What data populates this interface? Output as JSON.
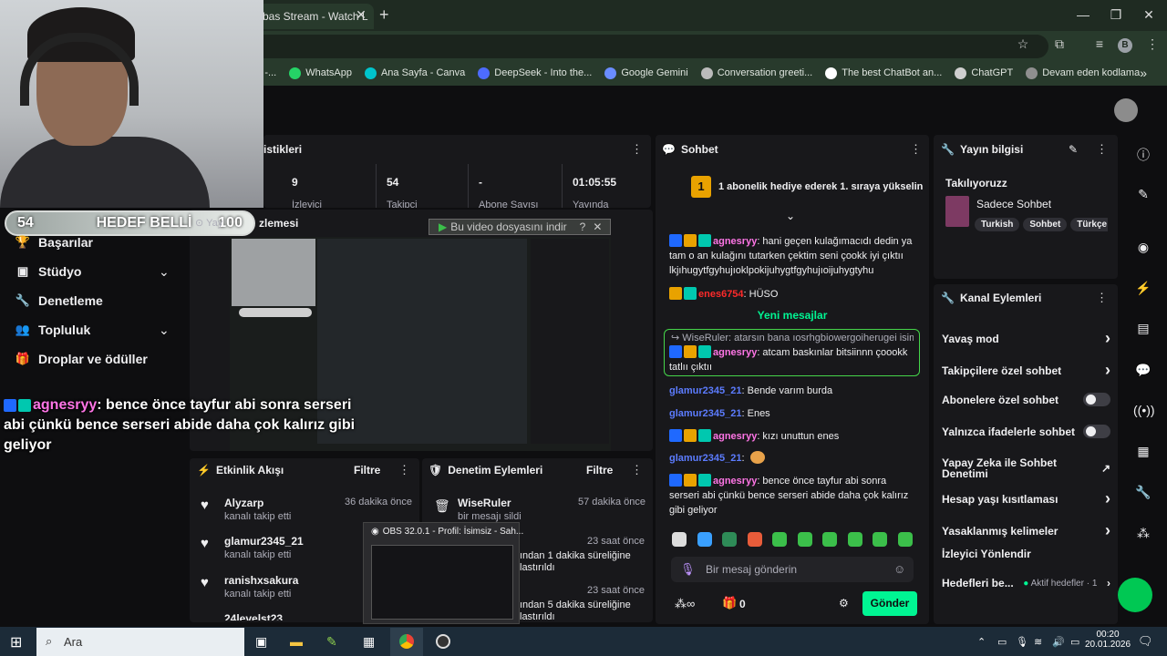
{
  "browser": {
    "tab_title": "bas Stream - Watch L",
    "close_tab": "✕",
    "new_tab": "+",
    "window_controls": {
      "minimize": "—",
      "maximize": "❐",
      "close": "✕"
    },
    "profile_initial": "B",
    "bookmarks": [
      {
        "label": "WiseRuler Stream -...",
        "color": "#8c8c8c"
      },
      {
        "label": "WhatsApp",
        "color": "#25d366"
      },
      {
        "label": "Ana Sayfa - Canva",
        "color": "#00c4cc"
      },
      {
        "label": "DeepSeek - Into the...",
        "color": "#4d6bfe"
      },
      {
        "label": "Google Gemini",
        "color": "#6a8cff"
      },
      {
        "label": "Conversation greeti...",
        "color": "#bbbbbb"
      },
      {
        "label": "The best ChatBot an...",
        "color": "#ffffff"
      },
      {
        "label": "ChatGPT",
        "color": "#cfcfcf"
      },
      {
        "label": "Devam eden kodlama",
        "color": "#8f8f8f"
      }
    ],
    "more_bookmarks": "»"
  },
  "goal": {
    "left": "54",
    "label": "HEDEF BELLİ",
    "right": "100"
  },
  "nav": {
    "items": [
      {
        "label": "Başarılar",
        "icon": "trophy-icon",
        "glyph": "🏆",
        "chevron": false
      },
      {
        "label": "Stüdyo",
        "icon": "studio-icon",
        "glyph": "▣",
        "chevron": true
      },
      {
        "label": "Denetleme",
        "icon": "sword-icon",
        "glyph": "🔧",
        "chevron": false
      },
      {
        "label": "Topluluk",
        "icon": "community-icon",
        "glyph": "👥",
        "chevron": true
      },
      {
        "label": "Droplar ve ödüller",
        "icon": "gift-icon",
        "glyph": "🎁",
        "chevron": false
      }
    ],
    "preview_title_left": "Yay",
    "preview_title_right": "zlemesi"
  },
  "overlay_chat": {
    "user": "agnesryy",
    "text": ": bence önce tayfur abi sonra serseri abi çünkü bence serseri abide daha çok kalırız gibi geliyor"
  },
  "stats": {
    "title": "istikleri",
    "values": [
      {
        "value": "9",
        "label": "İzleyici"
      },
      {
        "value": "54",
        "label": "Takipçi"
      },
      {
        "value": "-",
        "label": "Abone Sayısı"
      },
      {
        "value": "01:05:55",
        "label": "Yayında"
      }
    ]
  },
  "preview": {
    "download_text": "Bu video dosyasını indir",
    "help": "?",
    "close": "✕"
  },
  "activity": {
    "title": "Etkinlik Akışı",
    "filter": "Filtre",
    "items": [
      {
        "name": "Alyzarp",
        "sub": "kanalı takip etti",
        "time": "36 dakika önce"
      },
      {
        "name": "glamur2345_21",
        "sub": "kanalı takip etti",
        "time": ""
      },
      {
        "name": "ranishxsakura",
        "sub": "kanalı takip etti",
        "time": ""
      }
    ],
    "partial": "24levelst23"
  },
  "modlog": {
    "title": "Denetim Eylemleri",
    "filter": "Filtre",
    "items": [
      {
        "name": "WiseRuler",
        "sub": "bir mesajı sildi",
        "time": "57 dakika önce"
      },
      {
        "line1": "ından 1 dakika süreliğine",
        "line2": "lastırıldı",
        "time": "23 saat önce"
      },
      {
        "line1": "ından 5 dakika süreliğine",
        "line2": "lastırıldı",
        "time": "23 saat önce"
      }
    ]
  },
  "obs": {
    "title": "OBS 32.0.1 - Profil: İsimsiz - Sah..."
  },
  "chat": {
    "title": "Sohbet",
    "hype_rank": "1",
    "hype_text": "1 abonelik hediye ederek 1. sıraya yükselin",
    "new_messages": "Yeni mesajlar",
    "reply_context": "WiseRuler: atarsın bana ıosrhgbiowergoiherugei isimil...",
    "messages": [
      {
        "user": "agnesryy",
        "color": "#ff75e6",
        "text": ": hani geçen kulağımacıdı dedin ya tam o an kulağını tutarken çektim seni çookk iyi çıktıı lkjıhugytfgyhujıoklpokijuhygtfgyhujıoijuhygtyhu"
      },
      {
        "user": "enes6754",
        "color": "#ff2a2a",
        "text": ": HÜSO"
      },
      {
        "user": "agnesryy",
        "color": "#ff75e6",
        "text": ": atcam baskınlar bitsiinnn çoookk tatlıı çıktıı"
      },
      {
        "user": "glamur2345_21",
        "color": "#5c7cff",
        "text": ": Bende varım burda"
      },
      {
        "user": "glamur2345_21",
        "color": "#5c7cff",
        "text": ": Enes"
      },
      {
        "user": "agnesryy",
        "color": "#ff75e6",
        "text": ": kızı unuttun enes"
      },
      {
        "user": "glamur2345_21",
        "color": "#5c7cff",
        "text": ":"
      },
      {
        "user": "agnesryy",
        "color": "#ff75e6",
        "text": ": bence önce tayfur abi sonra serseri abi çünkü bence serseri abide daha çok kalırız gibi geliyor"
      }
    ],
    "input_placeholder": "Bir mesaj gönderin",
    "points": "0",
    "send": "Gönder"
  },
  "stream_info": {
    "title": "Yayın bilgisi",
    "stream_title": "Takılıyoruzz",
    "category": "Sadece Sohbet",
    "tags": [
      "Turkish",
      "Sohbet",
      "Türkçe"
    ]
  },
  "channel_actions": {
    "title": "Kanal Eylemleri",
    "items": [
      {
        "label": "Yavaş mod",
        "control": "arrow"
      },
      {
        "label": "Takipçilere özel sohbet",
        "control": "arrow"
      },
      {
        "label": "Abonelere özel sohbet",
        "control": "toggle"
      },
      {
        "label": "Yalnızca ifadelerle sohbet",
        "control": "toggle"
      },
      {
        "label": "Yapay Zeka ile Sohbet Denetimi",
        "control": "external"
      },
      {
        "label": "Hesap yaşı kısıtlaması",
        "control": "arrow"
      },
      {
        "label": "Yasaklanmış kelimeler",
        "control": "arrow"
      },
      {
        "label": "İzleyici Yönlendir",
        "control": "none"
      }
    ],
    "goals_label": "Hedefleri be...",
    "goals_status": "Aktif hedefler · 1"
  },
  "taskbar": {
    "search": "Ara",
    "time": "00:20",
    "date": "20.01.2026"
  }
}
